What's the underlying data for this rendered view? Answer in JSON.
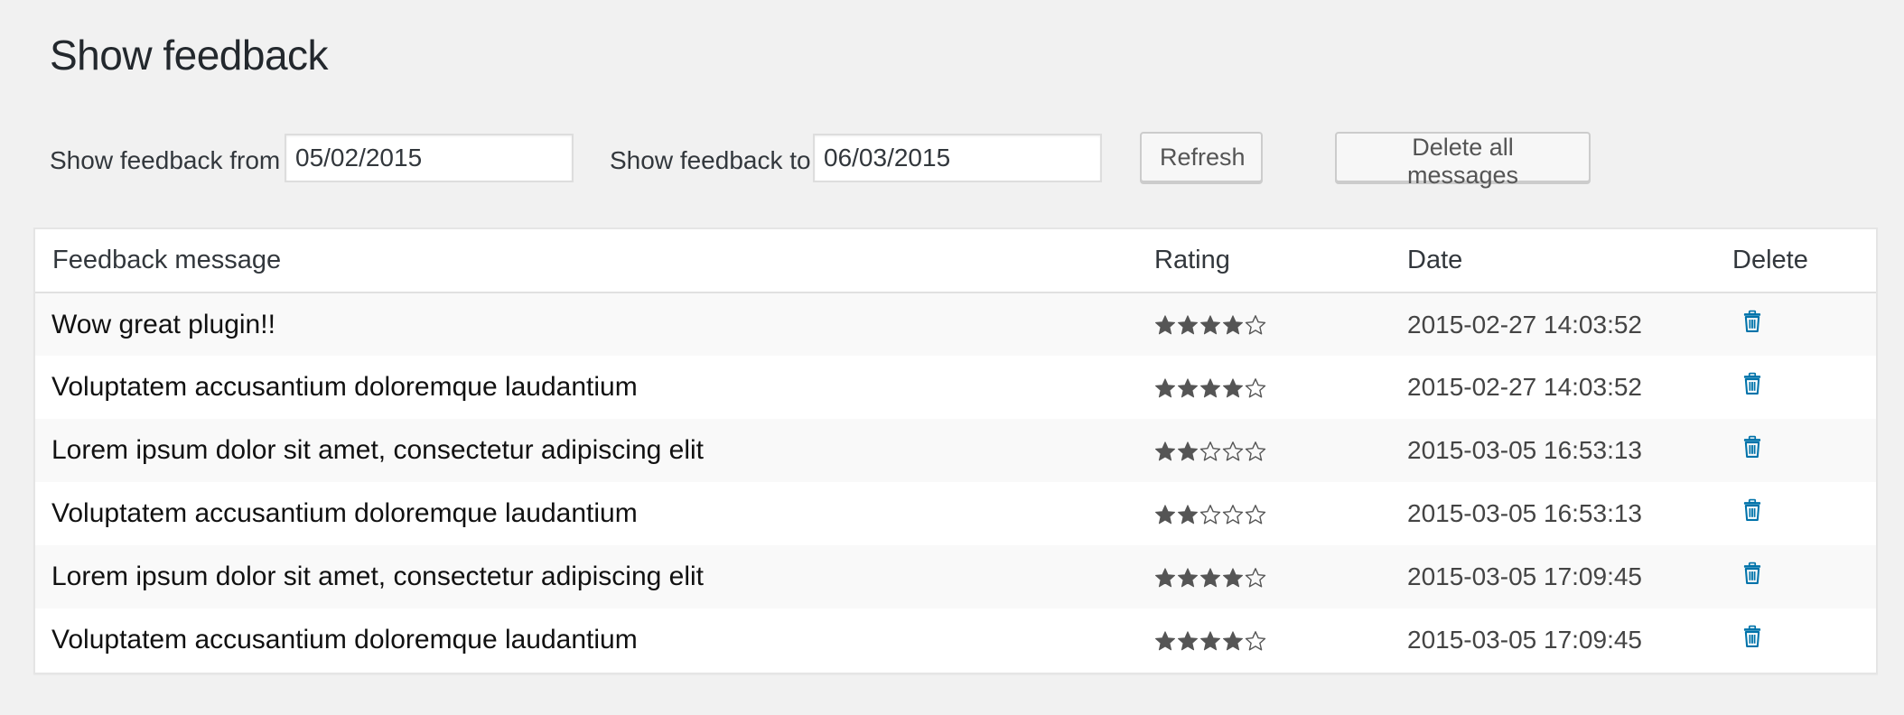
{
  "page": {
    "title": "Show feedback"
  },
  "filters": {
    "from_label": "Show feedback from",
    "from_value": "05/02/2015",
    "to_label": "Show feedback to",
    "to_value": "06/03/2015",
    "refresh_label": "Refresh",
    "delete_all_label": "Delete all messages"
  },
  "table": {
    "headers": {
      "message": "Feedback message",
      "rating": "Rating",
      "date": "Date",
      "delete": "Delete"
    },
    "max_rating": 5,
    "rows": [
      {
        "message": "Wow great plugin!!",
        "rating": 4,
        "date": "2015-02-27 14:03:52"
      },
      {
        "message": "Voluptatem accusantium doloremque laudantium",
        "rating": 4,
        "date": "2015-02-27 14:03:52"
      },
      {
        "message": "Lorem ipsum dolor sit amet, consectetur adipiscing elit",
        "rating": 2,
        "date": "2015-03-05 16:53:13"
      },
      {
        "message": "Voluptatem accusantium doloremque laudantium",
        "rating": 2,
        "date": "2015-03-05 16:53:13"
      },
      {
        "message": "Lorem ipsum dolor sit amet, consectetur adipiscing elit",
        "rating": 4,
        "date": "2015-03-05 17:09:45"
      },
      {
        "message": "Voluptatem accusantium doloremque laudantium",
        "rating": 4,
        "date": "2015-03-05 17:09:45"
      }
    ]
  },
  "icons": {
    "star_filled": "star-filled-icon",
    "star_empty": "star-empty-icon",
    "delete": "trash-icon"
  },
  "colors": {
    "star": "#555555",
    "trash": "#0073aa",
    "background": "#f1f1f1"
  }
}
